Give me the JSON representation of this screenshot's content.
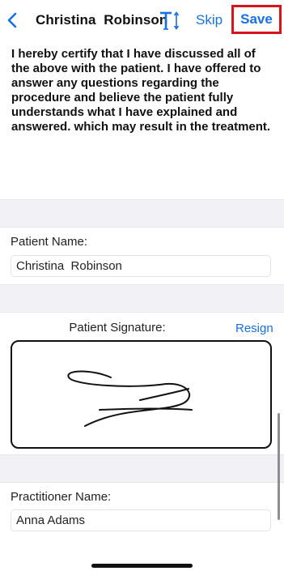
{
  "nav": {
    "title": "Christina  Robinson",
    "font_button_icon": "text-size-icon",
    "skip_label": "Skip",
    "save_label": "Save"
  },
  "certify_text": "I hereby certify that I have discussed all of the above with the patient. I have offered to answer any questions regarding the procedure and believe the patient fully understands what I have explained and answered. which may result in the treatment.",
  "patient": {
    "label": "Patient Name:",
    "value": "Christina  Robinson"
  },
  "signature": {
    "label": "Patient Signature:",
    "resign_label": "Resign"
  },
  "practitioner": {
    "label": "Practitioner Name:",
    "value": "Anna Adams"
  },
  "colors": {
    "accent": "#1a6fe0",
    "highlight_border": "#d9131e",
    "band": "#f2f2f6"
  }
}
